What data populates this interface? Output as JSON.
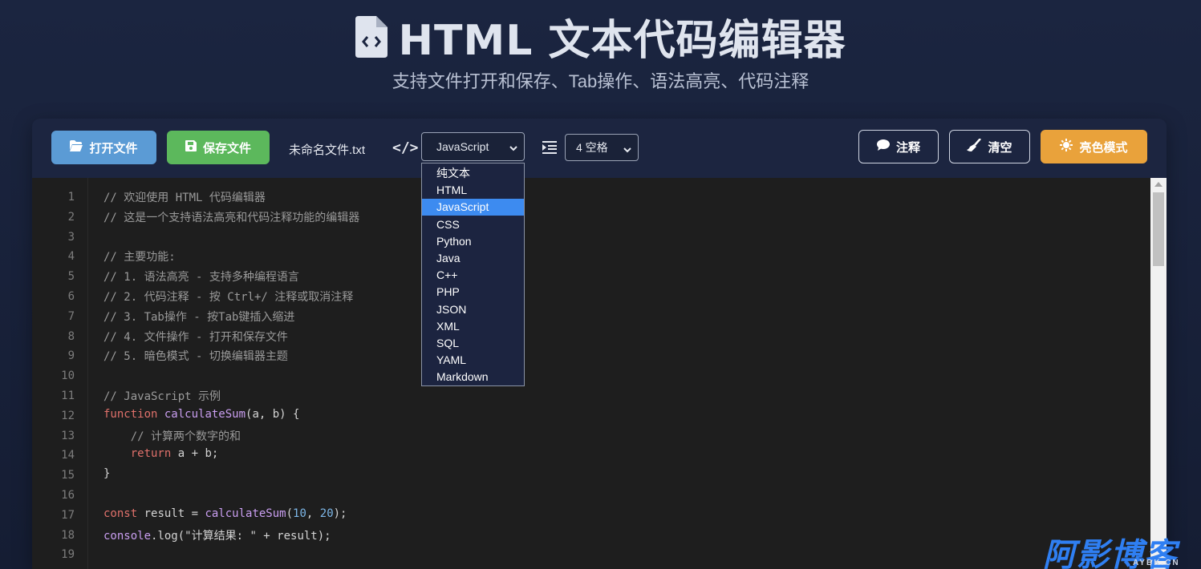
{
  "header": {
    "title": "HTML 文本代码编辑器",
    "subtitle": "支持文件打开和保存、Tab操作、语法高亮、代码注释"
  },
  "toolbar": {
    "open_label": "打开文件",
    "save_label": "保存文件",
    "filename": "未命名文件.txt",
    "code_icon": "</>",
    "language_selected": "JavaScript",
    "indent_selected": "4 空格",
    "comment_label": "注释",
    "clear_label": "清空",
    "theme_label": "亮色模式"
  },
  "language_options": [
    "纯文本",
    "HTML",
    "JavaScript",
    "CSS",
    "Python",
    "Java",
    "C++",
    "PHP",
    "JSON",
    "XML",
    "SQL",
    "YAML",
    "Markdown"
  ],
  "selected_language_index": 2,
  "editor": {
    "line_numbers": [
      "1",
      "2",
      "3",
      "4",
      "5",
      "6",
      "7",
      "8",
      "9",
      "10",
      "11",
      "12",
      "13",
      "14",
      "15",
      "16",
      "17",
      "18",
      "19"
    ],
    "lines": [
      [
        {
          "t": "// 欢迎使用 HTML 代码编辑器",
          "c": "comment"
        }
      ],
      [
        {
          "t": "// 这是一个支持语法高亮和代码注释功能的编辑器",
          "c": "comment"
        }
      ],
      [],
      [
        {
          "t": "// 主要功能:",
          "c": "comment"
        }
      ],
      [
        {
          "t": "// 1. 语法高亮 - 支持多种编程语言",
          "c": "comment"
        }
      ],
      [
        {
          "t": "// 2. 代码注释 - 按 Ctrl+/ 注释或取消注释",
          "c": "comment"
        }
      ],
      [
        {
          "t": "// 3. Tab操作 - 按Tab键插入缩进",
          "c": "comment"
        }
      ],
      [
        {
          "t": "// 4. 文件操作 - 打开和保存文件",
          "c": "comment"
        }
      ],
      [
        {
          "t": "// 5. 暗色模式 - 切换编辑器主题",
          "c": "comment"
        }
      ],
      [],
      [
        {
          "t": "// JavaScript 示例",
          "c": "comment"
        }
      ],
      [
        {
          "t": "function",
          "c": "kw"
        },
        {
          "t": " "
        },
        {
          "t": "calculateSum",
          "c": "fn"
        },
        {
          "t": "(a, b) {"
        }
      ],
      [
        {
          "t": "    // 计算两个数字的和",
          "c": "comment"
        }
      ],
      [
        {
          "t": "    "
        },
        {
          "t": "return",
          "c": "kw"
        },
        {
          "t": " a + b;"
        }
      ],
      [
        {
          "t": "}"
        }
      ],
      [],
      [
        {
          "t": "const",
          "c": "kw"
        },
        {
          "t": " result = "
        },
        {
          "t": "calculateSum",
          "c": "fn"
        },
        {
          "t": "("
        },
        {
          "t": "10",
          "c": "num"
        },
        {
          "t": ", "
        },
        {
          "t": "20",
          "c": "num"
        },
        {
          "t": ");"
        }
      ],
      [
        {
          "t": "console",
          "c": "builtin"
        },
        {
          "t": ".log(\"计算结果: \" + result);"
        }
      ],
      []
    ]
  },
  "watermark": {
    "main": "阿影博客",
    "sub": "AYBK.CN"
  },
  "colors": {
    "open_button": "#5b9bd5",
    "save_button": "#5cb85c",
    "theme_button": "#e9a23b",
    "selected_option": "#3d8bf0",
    "keyword": "#e0716b",
    "function": "#c99ef0",
    "number": "#7db7e8"
  }
}
